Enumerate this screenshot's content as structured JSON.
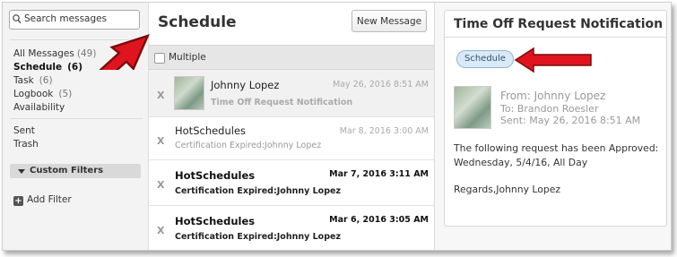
{
  "sidebar": {
    "search_placeholder": "Search messages",
    "items": [
      {
        "label": "All Messages",
        "count": "(49)"
      },
      {
        "label": "Schedule",
        "count": "(6)"
      },
      {
        "label": "Task",
        "count": "(6)"
      },
      {
        "label": "Logbook",
        "count": "(5)"
      },
      {
        "label": "Availability",
        "count": ""
      }
    ],
    "sent": "Sent",
    "trash": "Trash",
    "custom_filters": "Custom Filters",
    "add_filter": "Add Filter"
  },
  "middle": {
    "title": "Schedule",
    "new_message": "New Message",
    "multiple": "Multiple",
    "messages": [
      {
        "from": "Johnny Lopez",
        "subject": "Time Off Request Notification",
        "date": "May 26, 2016 8:51 AM"
      },
      {
        "from": "HotSchedules",
        "subject": "Certification Expired:Johnny Lopez",
        "date": "Mar 8, 2016 3:00 AM"
      },
      {
        "from": "HotSchedules",
        "subject": "Certification Expired:Johnny Lopez",
        "date": "Mar 7, 2016 3:11 AM"
      },
      {
        "from": "HotSchedules",
        "subject": "Certification Expired:Johnny Lopez",
        "date": "Mar 6, 2016 3:05 AM"
      }
    ],
    "delete_glyph": "X"
  },
  "detail": {
    "title": "Time Off Request Notification",
    "tag": "Schedule",
    "from": "From: Johnny Lopez",
    "to": "To: Brandon Roesler",
    "sent": "Sent: May 26, 2016 8:51 AM",
    "body_line1": "The following request has been Approved:",
    "body_line2": "Wednesday, 5/4/16, All Day",
    "signature": "Regards,Johnny Lopez"
  },
  "colors": {
    "arrow": "#e0141e",
    "tag_bg": "#dbe9f6"
  }
}
